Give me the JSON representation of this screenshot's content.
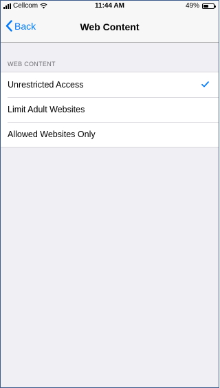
{
  "status_bar": {
    "carrier": "Cellcom",
    "time": "11:44 AM",
    "battery_percent": "49%",
    "battery_level": 0.49,
    "signal_icon": "signal-bars-icon",
    "wifi_icon": "wifi-icon"
  },
  "nav": {
    "back_label": "Back",
    "title": "Web Content"
  },
  "section": {
    "header": "WEB CONTENT"
  },
  "options": [
    {
      "label": "Unrestricted Access",
      "selected": true
    },
    {
      "label": "Limit Adult Websites",
      "selected": false
    },
    {
      "label": "Allowed Websites Only",
      "selected": false
    }
  ],
  "colors": {
    "accent": "#007aff",
    "background": "#efeff4"
  }
}
